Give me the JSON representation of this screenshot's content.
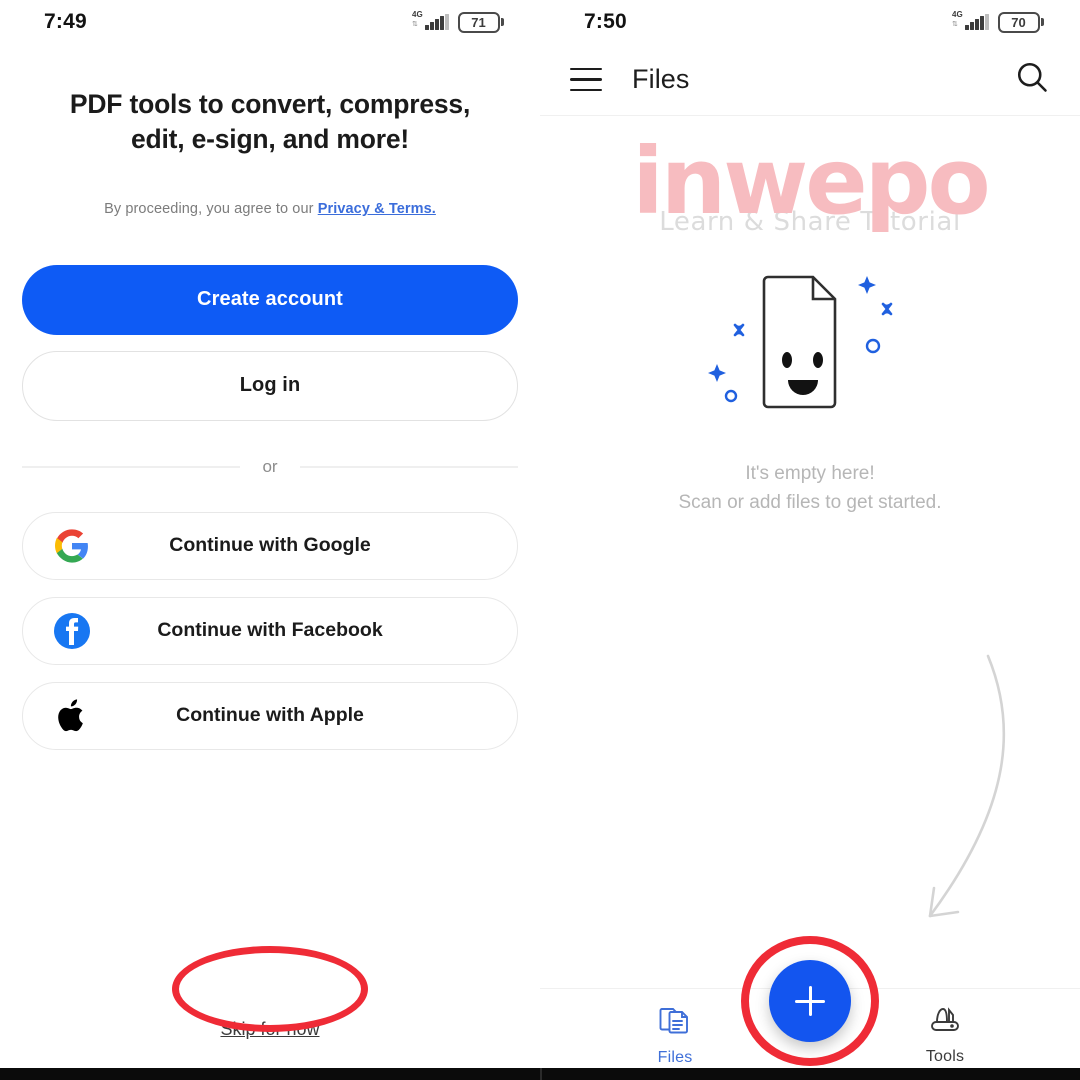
{
  "left_screen": {
    "status_bar": {
      "time": "7:49",
      "network": "4G",
      "battery_level": "71"
    },
    "headline": "PDF tools to convert, compress, edit, e-sign, and more!",
    "legal_prefix": "By proceeding, you agree to our ",
    "legal_link": "Privacy & Terms.",
    "primary_button": "Create account",
    "secondary_button": "Log in",
    "divider_label": "or",
    "social_buttons": [
      {
        "label": "Continue with Google",
        "icon": "google-icon"
      },
      {
        "label": "Continue with Facebook",
        "icon": "facebook-icon"
      },
      {
        "label": "Continue with Apple",
        "icon": "apple-icon"
      }
    ],
    "skip_link": "Skip for now",
    "annotation": {
      "shape": "ellipse",
      "color": "#ef2b36",
      "target": "skip-for-now-link"
    }
  },
  "right_screen": {
    "status_bar": {
      "time": "7:50",
      "network": "4G",
      "battery_level": "70"
    },
    "app_bar": {
      "menu_icon": "hamburger-menu-icon",
      "title": "Files",
      "search_icon": "search-icon"
    },
    "watermark": {
      "main": "inwepo",
      "sub": "Learn & Share Tutorial",
      "color": "#f7bcc0"
    },
    "empty_state": {
      "illustration": "smiling-document-icon",
      "line1": "It's empty here!",
      "line2": "Scan or add files to get started."
    },
    "arrow_hint": "curved-arrow-pointing-to-add-button",
    "fab": {
      "icon": "plus-icon",
      "color": "#1355ef"
    },
    "annotation": {
      "shape": "circle",
      "color": "#ef2b36",
      "target": "add-file-fab"
    },
    "bottom_nav": [
      {
        "label": "Files",
        "icon": "files-icon",
        "active": true
      },
      {
        "label": "Tools",
        "icon": "tools-icon",
        "active": false
      }
    ]
  }
}
